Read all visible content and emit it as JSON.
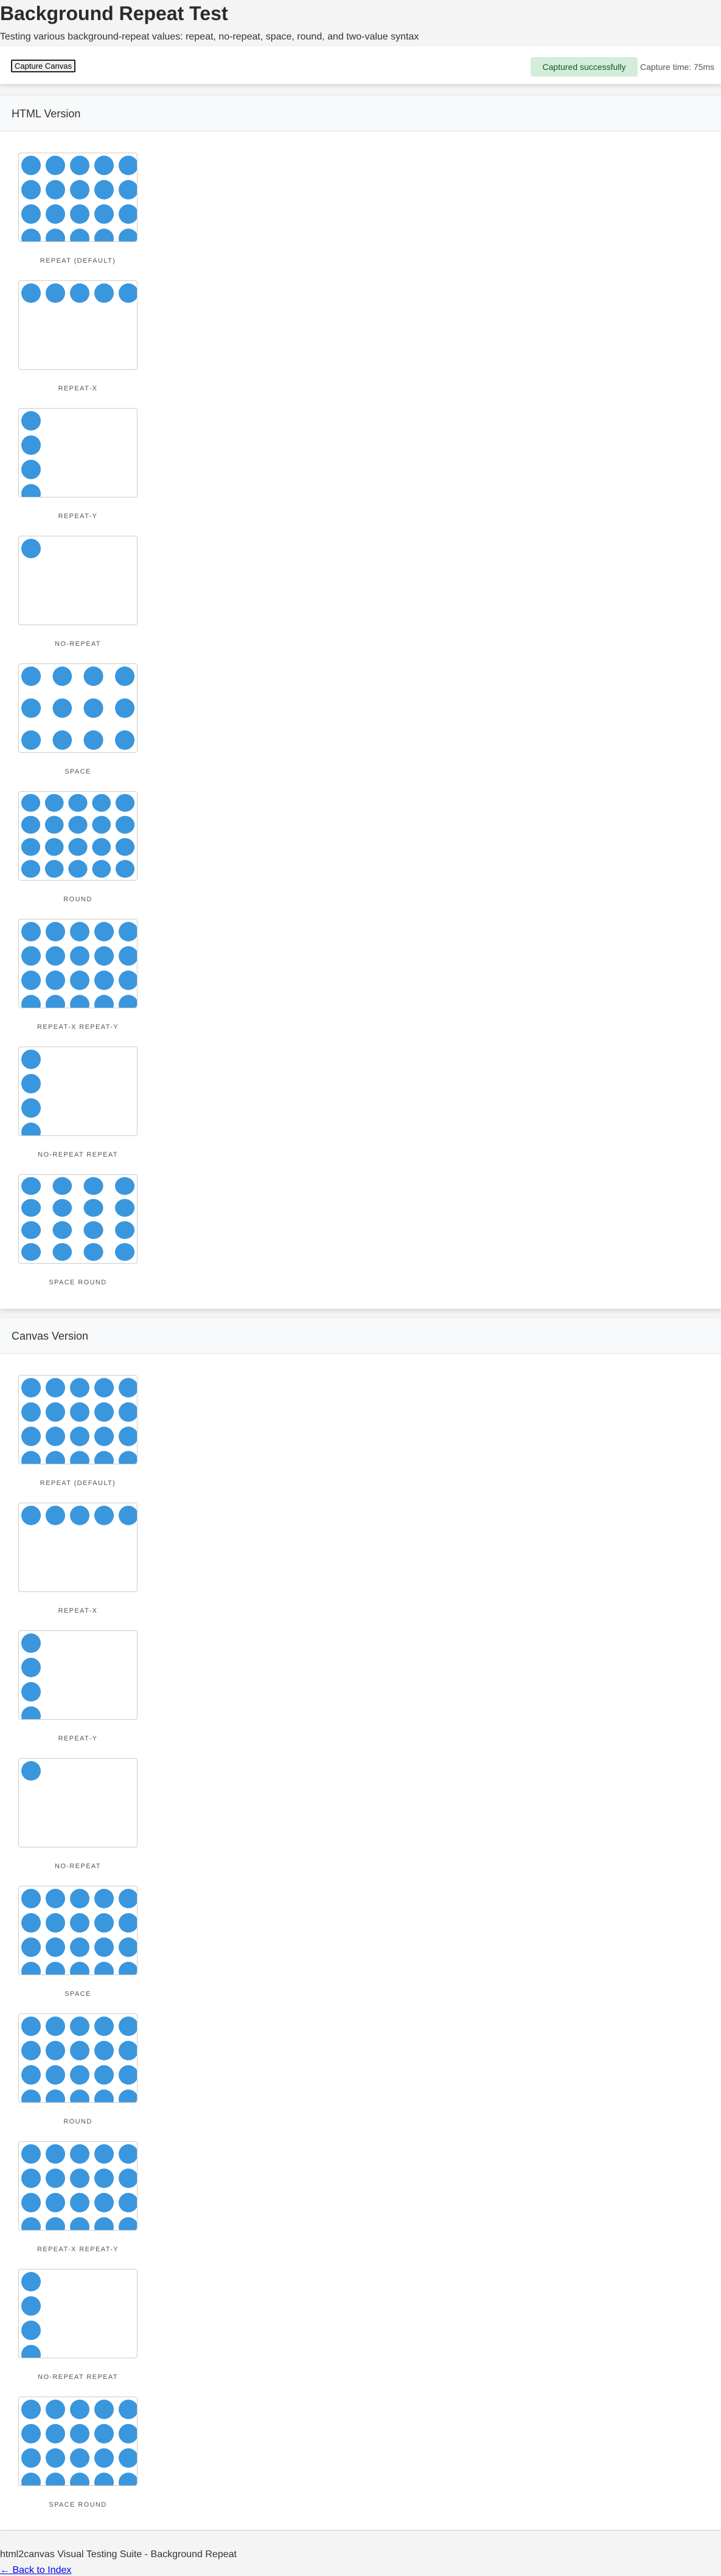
{
  "page": {
    "title": "Background Repeat Test",
    "subtitle": "Testing various background-repeat values: repeat, no-repeat, space, round, and two-value syntax"
  },
  "toolbar": {
    "capture_label": "Capture Canvas",
    "status": "Captured successfully",
    "capture_time": "Capture time: 75ms"
  },
  "colors": {
    "dot": "#3a96dd",
    "status_bg": "#d4edda",
    "status_text": "#155724"
  },
  "sections": [
    {
      "title": "HTML Version",
      "cases": [
        {
          "label": "REPEAT (DEFAULT)",
          "repeat": "repeat"
        },
        {
          "label": "REPEAT-X",
          "repeat": "repeat-x"
        },
        {
          "label": "REPEAT-Y",
          "repeat": "repeat-y"
        },
        {
          "label": "NO-REPEAT",
          "repeat": "no-repeat"
        },
        {
          "label": "SPACE",
          "repeat": "space"
        },
        {
          "label": "ROUND",
          "repeat": "round"
        },
        {
          "label": "REPEAT-X REPEAT-Y",
          "repeat": "repeat"
        },
        {
          "label": "NO-REPEAT REPEAT",
          "repeat": "no-repeat repeat"
        },
        {
          "label": "SPACE ROUND",
          "repeat": "space round"
        }
      ]
    },
    {
      "title": "Canvas Version",
      "cases": [
        {
          "label": "REPEAT (DEFAULT)",
          "repeat": "repeat"
        },
        {
          "label": "REPEAT-X",
          "repeat": "repeat-x"
        },
        {
          "label": "REPEAT-Y",
          "repeat": "repeat-y"
        },
        {
          "label": "NO-REPEAT",
          "repeat": "no-repeat"
        },
        {
          "label": "SPACE",
          "repeat": "repeat"
        },
        {
          "label": "ROUND",
          "repeat": "repeat"
        },
        {
          "label": "REPEAT-X REPEAT-Y",
          "repeat": "repeat"
        },
        {
          "label": "NO-REPEAT REPEAT",
          "repeat": "no-repeat repeat"
        },
        {
          "label": "SPACE ROUND",
          "repeat": "repeat"
        }
      ]
    }
  ],
  "footer": {
    "text": "html2canvas Visual Testing Suite - Background Repeat",
    "back_link": "← Back to Index"
  }
}
